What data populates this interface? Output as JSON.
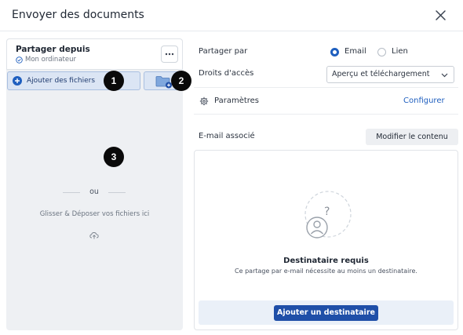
{
  "dialog": {
    "title": "Envoyer des documents"
  },
  "left_panel": {
    "share_from_title": "Partager depuis",
    "share_from_source": "Mon ordinateur",
    "add_files_label": "Ajouter des fichiers",
    "or_label": "ou",
    "drop_text": "Glisser & Déposer vos fichiers ici"
  },
  "badges": [
    "1",
    "2",
    "3"
  ],
  "right_panel": {
    "share_by_label": "Partager par",
    "share_by_options": [
      {
        "label": "Email",
        "selected": true
      },
      {
        "label": "Lien",
        "selected": false
      }
    ],
    "access_label": "Droits d'accès",
    "access_value": "Aperçu et téléchargement",
    "settings_label": "Paramètres",
    "configure_link": "Configurer",
    "email_label": "E-mail associé",
    "edit_content_button": "Modifier le contenu",
    "recipient_required_title": "Destinataire requis",
    "recipient_required_text": "Ce partage par e-mail nécessite au moins un destinataire.",
    "add_recipient_button": "Ajouter un destinataire"
  },
  "icons": {
    "close": "close-icon",
    "more": "more-dots-icon",
    "add_files": "plus-circle-icon",
    "add_folder": "folder-plus-icon",
    "upload": "cloud-upload-icon",
    "settings": "gear-icon",
    "chevron": "chevron-down-icon",
    "recipient": "user-question-icon"
  },
  "colors": {
    "accent": "#1f5fbf",
    "primary_button": "#1f4fa8",
    "badge": "#0a0a0a",
    "left_panel_bg": "#eef0f3"
  }
}
